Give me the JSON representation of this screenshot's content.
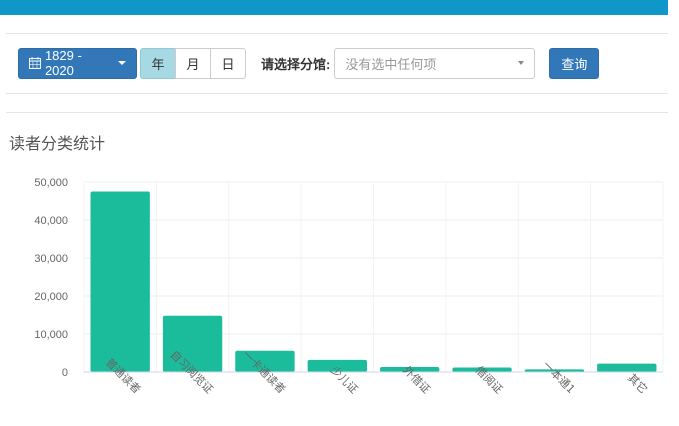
{
  "toolbar": {
    "date_range": "1829 - 2020",
    "period_tabs": [
      {
        "label": "年",
        "active": true
      },
      {
        "label": "月",
        "active": false
      },
      {
        "label": "日",
        "active": false
      }
    ],
    "library_label": "请选择分馆:",
    "library_select_placeholder": "没有选中任何项",
    "query_label": "查询"
  },
  "section": {
    "title": "读者分类统计"
  },
  "colors": {
    "header": "#0f97c9",
    "primary": "#3278b8",
    "bar": "#1bbc9b"
  },
  "chart_data": {
    "type": "bar",
    "title": "",
    "xlabel": "",
    "ylabel": "",
    "ylim": [
      0,
      50000
    ],
    "yticks": [
      0,
      10000,
      20000,
      30000,
      40000,
      50000
    ],
    "ytick_labels": [
      "0",
      "10,000",
      "20,000",
      "30,000",
      "40,000",
      "50,000"
    ],
    "categories": [
      "普通读者",
      "自习阅览证",
      "一卡通读者",
      "少儿证",
      "外借证",
      "借阅证",
      "一本通1",
      "其它"
    ],
    "values": [
      47500,
      14800,
      5600,
      3200,
      1300,
      1200,
      700,
      2200
    ]
  }
}
